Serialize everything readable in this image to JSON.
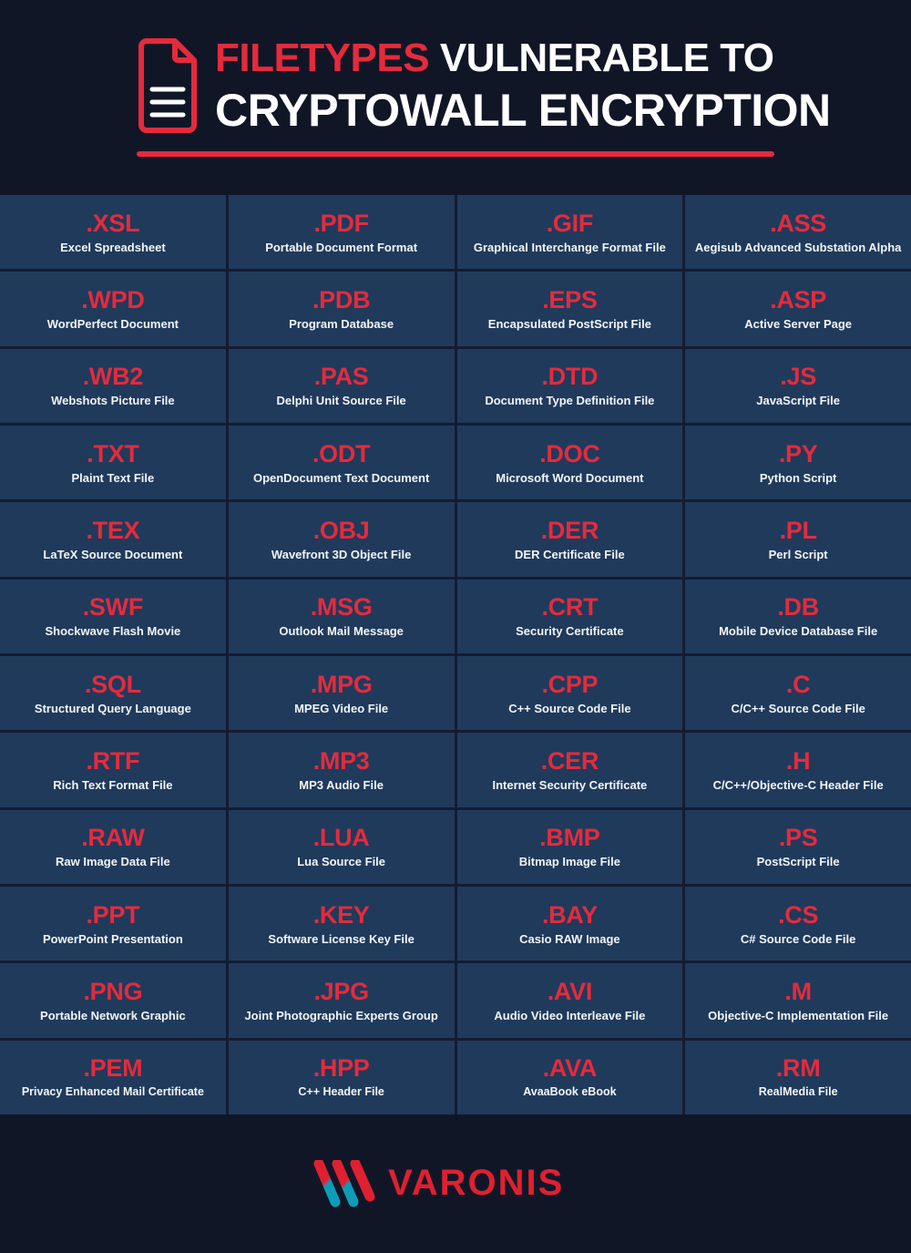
{
  "header": {
    "icon": "document-icon",
    "title_line_1_accent": "FILETYPES",
    "title_line_1_rest": " VULNERABLE TO",
    "title_line_2": "CRYPTOWALL ENCRYPTION",
    "accent_color": "#e42b3c",
    "background_color": "#111627"
  },
  "grid": {
    "columns": 4,
    "rows": 12,
    "cell_background": "#203a5c",
    "extension_color": "#e42b3c",
    "description_color": "#f2f5f8",
    "items": [
      {
        "ext": ".XSL",
        "desc": "Excel Spreadsheet"
      },
      {
        "ext": ".PDF",
        "desc": "Portable Document Format"
      },
      {
        "ext": ".GIF",
        "desc": "Graphical Interchange Format File"
      },
      {
        "ext": ".ASS",
        "desc": "Aegisub Advanced Substation Alpha"
      },
      {
        "ext": ".WPD",
        "desc": "WordPerfect Document"
      },
      {
        "ext": ".PDB",
        "desc": "Program Database"
      },
      {
        "ext": ".EPS",
        "desc": "Encapsulated PostScript File"
      },
      {
        "ext": ".ASP",
        "desc": "Active Server Page"
      },
      {
        "ext": ".WB2",
        "desc": "Webshots Picture File"
      },
      {
        "ext": ".PAS",
        "desc": "Delphi Unit Source File"
      },
      {
        "ext": ".DTD",
        "desc": "Document Type Definition File"
      },
      {
        "ext": ".JS",
        "desc": "JavaScript File"
      },
      {
        "ext": ".TXT",
        "desc": "Plaint Text File"
      },
      {
        "ext": ".ODT",
        "desc": "OpenDocument Text Document"
      },
      {
        "ext": ".DOC",
        "desc": "Microsoft Word Document"
      },
      {
        "ext": ".PY",
        "desc": "Python Script"
      },
      {
        "ext": ".TEX",
        "desc": "LaTeX Source Document"
      },
      {
        "ext": ".OBJ",
        "desc": "Wavefront 3D Object File"
      },
      {
        "ext": ".DER",
        "desc": "DER Certificate File"
      },
      {
        "ext": ".PL",
        "desc": "Perl Script"
      },
      {
        "ext": ".SWF",
        "desc": "Shockwave Flash Movie"
      },
      {
        "ext": ".MSG",
        "desc": "Outlook Mail Message"
      },
      {
        "ext": ".CRT",
        "desc": "Security Certificate"
      },
      {
        "ext": ".DB",
        "desc": "Mobile Device Database File"
      },
      {
        "ext": ".SQL",
        "desc": "Structured Query Language"
      },
      {
        "ext": ".MPG",
        "desc": "MPEG Video File"
      },
      {
        "ext": ".CPP",
        "desc": "C++ Source Code File"
      },
      {
        "ext": ".C",
        "desc": "C/C++ Source Code File"
      },
      {
        "ext": ".RTF",
        "desc": "Rich Text Format File"
      },
      {
        "ext": ".MP3",
        "desc": "MP3 Audio File"
      },
      {
        "ext": ".CER",
        "desc": "Internet Security Certificate"
      },
      {
        "ext": ".H",
        "desc": "C/C++/Objective-C Header File"
      },
      {
        "ext": ".RAW",
        "desc": "Raw Image Data File"
      },
      {
        "ext": ".LUA",
        "desc": "Lua Source File"
      },
      {
        "ext": ".BMP",
        "desc": "Bitmap Image File"
      },
      {
        "ext": ".PS",
        "desc": "PostScript File"
      },
      {
        "ext": ".PPT",
        "desc": "PowerPoint Presentation"
      },
      {
        "ext": ".KEY",
        "desc": "Software License Key File"
      },
      {
        "ext": ".BAY",
        "desc": "Casio RAW Image"
      },
      {
        "ext": ".CS",
        "desc": "C# Source Code File"
      },
      {
        "ext": ".PNG",
        "desc": "Portable Network Graphic"
      },
      {
        "ext": ".JPG",
        "desc": "Joint Photographic Experts Group"
      },
      {
        "ext": ".AVI",
        "desc": "Audio Video Interleave File"
      },
      {
        "ext": ".M",
        "desc": "Objective-C Implementation File"
      },
      {
        "ext": ".PEM",
        "desc": "Privacy Enhanced Mail Certificate"
      },
      {
        "ext": ".HPP",
        "desc": "C++ Header File"
      },
      {
        "ext": ".AVA",
        "desc": "AvaaBook eBook"
      },
      {
        "ext": ".RM",
        "desc": "RealMedia File"
      }
    ]
  },
  "footer": {
    "logo_wordmark": "VARONIS",
    "logo_mark_color_primary": "#e02030",
    "logo_mark_color_secondary": "#0e9cb8",
    "background_color": "#111627"
  }
}
